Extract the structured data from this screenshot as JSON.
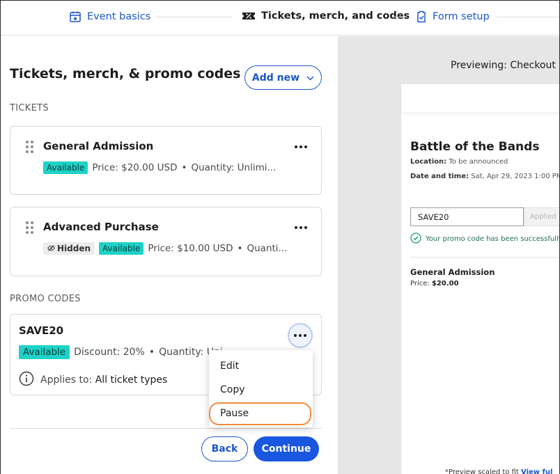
{
  "stepper": {
    "steps": [
      {
        "label": "Event basics",
        "icon": "calendar-star-icon",
        "state": "link"
      },
      {
        "label": "Tickets, merch, and codes",
        "icon": "ticket-percent-icon",
        "state": "current"
      },
      {
        "label": "Form setup",
        "icon": "clipboard-check-icon",
        "state": "link"
      }
    ]
  },
  "left": {
    "title": "Tickets, merch, & promo codes",
    "add_new_label": "Add new",
    "tickets_label": "TICKETS",
    "tickets": [
      {
        "name": "General Admission",
        "hidden": "",
        "status": "Available",
        "price": "Price: $20.00 USD",
        "quantity": "Quantity: Unlimi..."
      },
      {
        "name": "Advanced Purchase",
        "hidden": "Hidden",
        "status": "Available",
        "price": "Price: $10.00 USD",
        "quantity": "Quanti..."
      }
    ],
    "promo_label": "PROMO CODES",
    "promo": {
      "code": "SAVE20",
      "status": "Available",
      "discount": "Discount: 20%",
      "quantity": "Quantity: Uni",
      "applies_prefix": "Applies to:",
      "applies_value": "All ticket types"
    },
    "menu": [
      "Edit",
      "Copy",
      "Pause"
    ],
    "back_label": "Back",
    "continue_label": "Continue"
  },
  "preview": {
    "label": "Previewing: Checkout ex",
    "event_title": "Battle of the Bands",
    "location_label": "Location:",
    "location_value": "To be announced",
    "date_label": "Date and time:",
    "date_value": "Sat, Apr 29, 2023 1:00 PM",
    "promo_value": "SAVE20",
    "applied_label": "Applied",
    "success_text": "Your promo code has been successfully",
    "ticket_name": "General Admission",
    "price_label": "Price:",
    "price_value": "$20.00",
    "note_text": "*Preview scaled to fit",
    "note_link": "View ful"
  },
  "colors": {
    "accent": "#1a57c9",
    "available": "#1fd2c7",
    "focus_ring": "#f08a3e"
  }
}
